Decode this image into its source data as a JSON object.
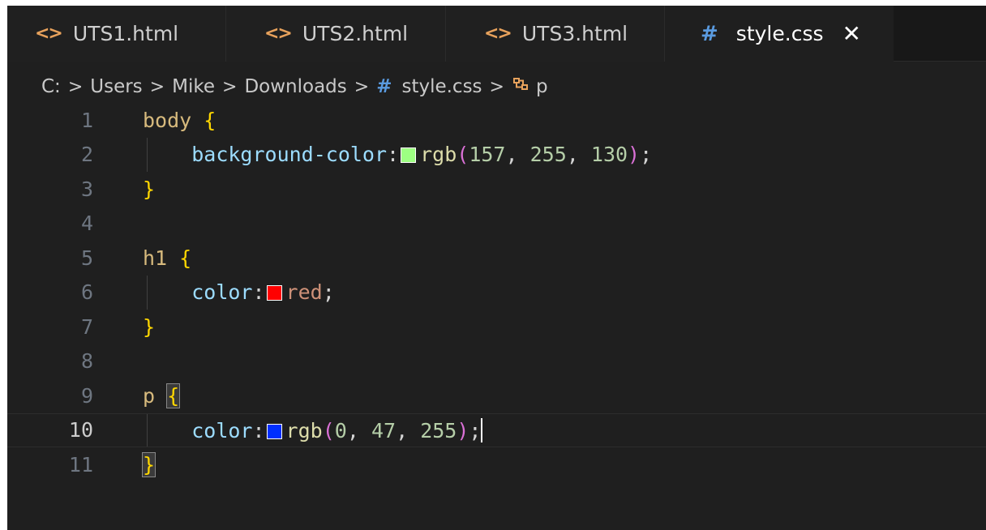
{
  "tabs": [
    {
      "label": "UTS1.html",
      "icon": "html-icon"
    },
    {
      "label": "UTS2.html",
      "icon": "html-icon"
    },
    {
      "label": "UTS3.html",
      "icon": "html-icon"
    },
    {
      "label": "style.css",
      "icon": "css-hash-icon",
      "active": true
    }
  ],
  "tab_icons": {
    "html": "<>",
    "css": "#",
    "close": "✕"
  },
  "breadcrumb": {
    "drive": "C:",
    "sep": ">",
    "parts": [
      "Users",
      "Mike",
      "Downloads"
    ],
    "file": "style.css",
    "symbol": "p"
  },
  "lines": {
    "n1": "1",
    "n2": "2",
    "n3": "3",
    "n4": "4",
    "n5": "5",
    "n6": "6",
    "n7": "7",
    "n8": "8",
    "n9": "9",
    "n10": "10",
    "n11": "11",
    "l1_sel": "body",
    "l1_brace": "{",
    "l2_prop": "background-color",
    "l2_colon": ":",
    "l2_fn": "rgb",
    "l2_open": "(",
    "l2_v1": "157",
    "l2_v2": "255",
    "l2_v3": "130",
    "l2_close": ")",
    "l2_semi": ";",
    "l3_brace": "}",
    "l5_sel": "h1",
    "l5_brace": "{",
    "l6_prop": "color",
    "l6_colon": ":",
    "l6_val": "red",
    "l6_semi": ";",
    "l7_brace": "}",
    "l9_sel": "p",
    "l9_brace": "{",
    "l10_prop": "color",
    "l10_colon": ":",
    "l10_fn": "rgb",
    "l10_open": "(",
    "l10_v1": "0",
    "l10_v2": "47",
    "l10_v3": "255",
    "l10_close": ")",
    "l10_semi": ";",
    "l11_brace": "}",
    "comma": ","
  },
  "colors": {
    "swatch_green": "#9dff82",
    "swatch_red": "#ff0000",
    "swatch_blue": "#002fff"
  },
  "cursor_line": "10"
}
